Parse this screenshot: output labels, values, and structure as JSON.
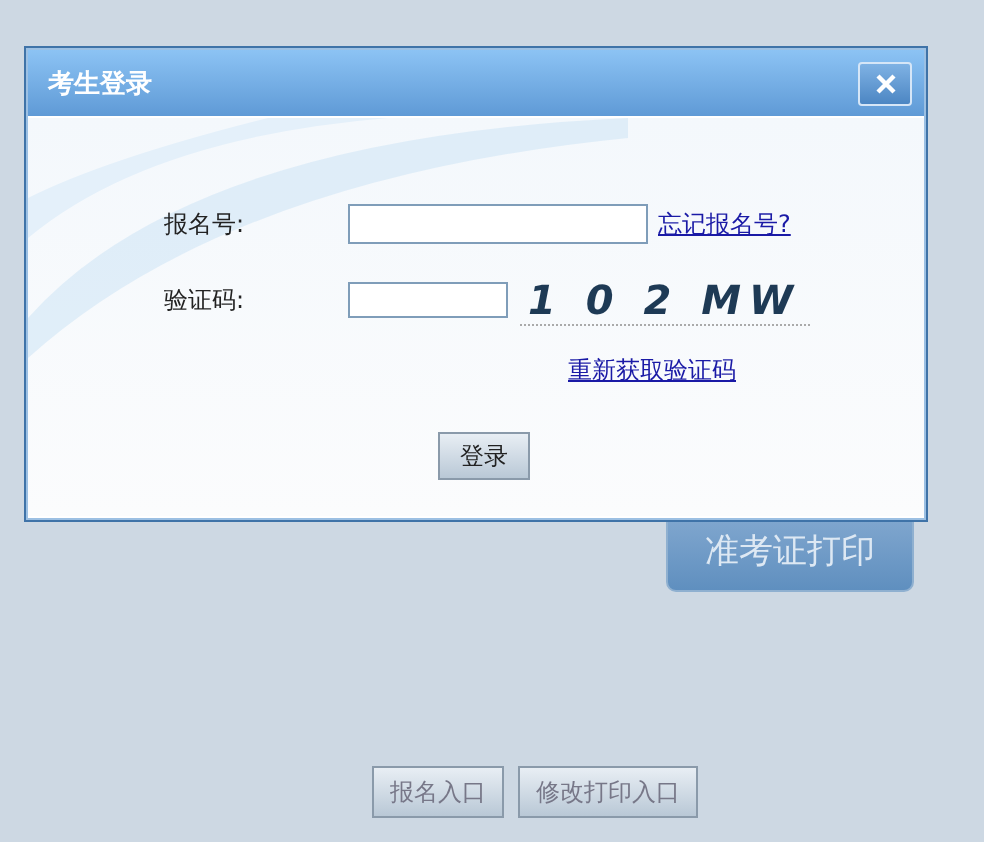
{
  "page": {
    "print_button": "准考证打印",
    "buttons": [
      "报名入口",
      "修改打印入口"
    ]
  },
  "dialog": {
    "title": "考生登录",
    "fields": [
      {
        "label": "报名号:",
        "kind": "text",
        "link": "忘记报名号?"
      },
      {
        "label": "验证码:",
        "kind": "captcha",
        "captcha": "1 0 2 MW"
      }
    ],
    "refresh_link": "重新获取验证码",
    "submit": "登录"
  }
}
